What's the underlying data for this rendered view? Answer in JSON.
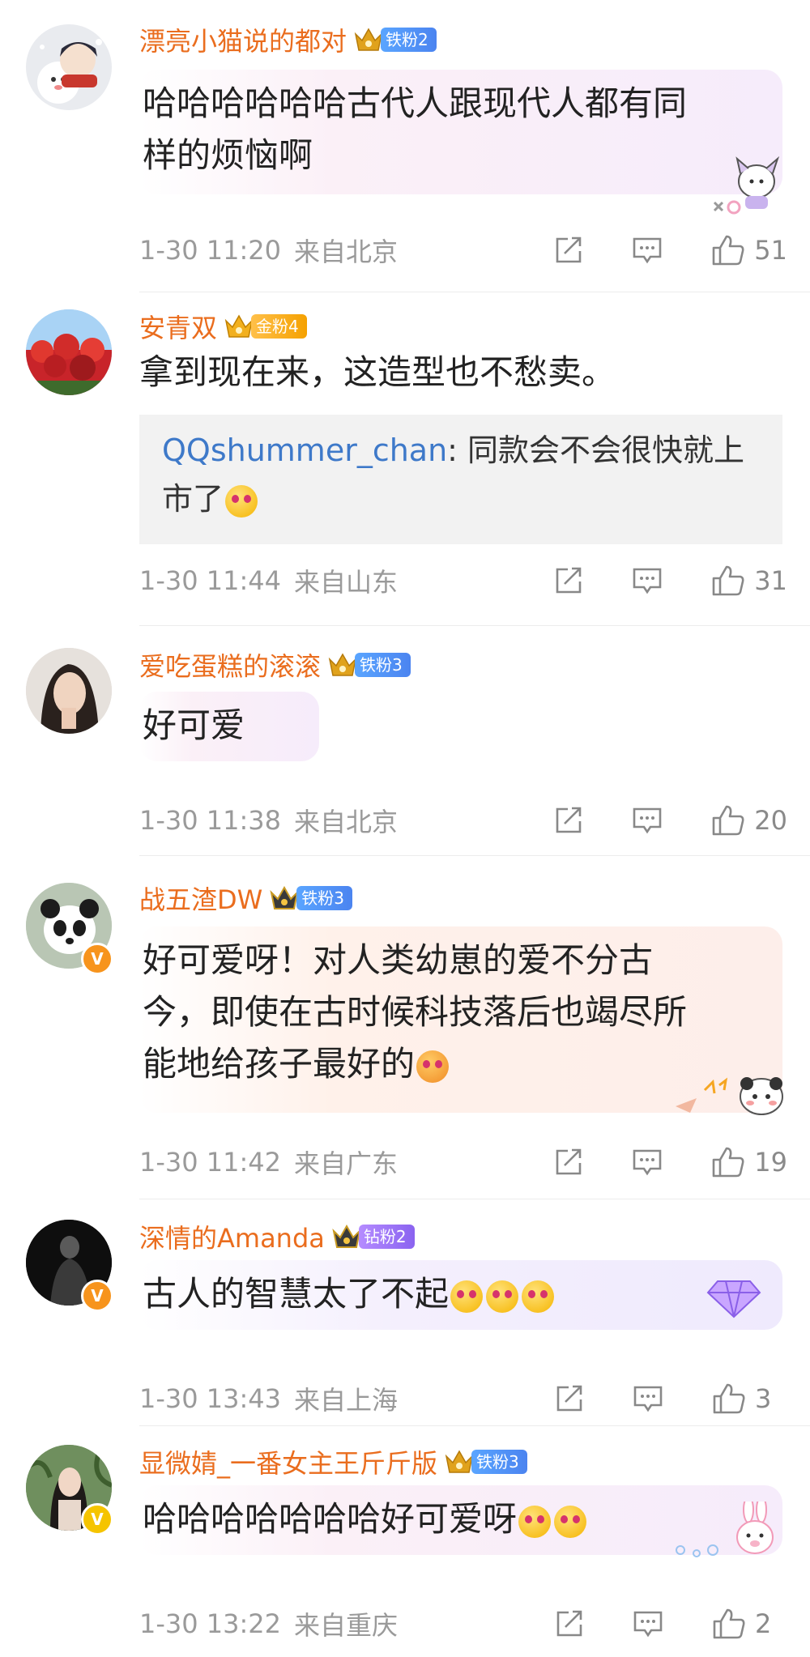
{
  "comments": [
    {
      "username": "漂亮小猫说的都对",
      "fan_badge": "铁粉2",
      "text_lines": [
        "哈哈哈哈哈哈古代人跟现代人都有同",
        "样的烦恼啊"
      ],
      "time": "1-30 11:20",
      "location": "来自北京",
      "likes": "51"
    },
    {
      "username": "安青双",
      "fan_badge": "金粉4",
      "text": "拿到现在来，这造型也不愁卖。",
      "quote_user": "QQshummer_chan",
      "quote_text_1": ": 同款会不会很快就上",
      "quote_text_2": "市了",
      "time": "1-30 11:44",
      "location": "来自山东",
      "likes": "31"
    },
    {
      "username": "爱吃蛋糕的滚滚",
      "fan_badge": "铁粉3",
      "text": "好可爱",
      "time": "1-30 11:38",
      "location": "来自北京",
      "likes": "20"
    },
    {
      "username": "战五渣DW",
      "fan_badge": "铁粉3",
      "text_lines": [
        "好可爱呀！对人类幼崽的爱不分古",
        "今，即使在古时候科技落后也竭尽所",
        "能地给孩子最好的"
      ],
      "time": "1-30 11:42",
      "location": "来自广东",
      "likes": "19"
    },
    {
      "username": "深情的Amanda",
      "fan_badge": "钻粉2",
      "text": "古人的智慧太了不起",
      "time": "1-30 13:43",
      "location": "来自上海",
      "likes": "3"
    },
    {
      "username": "显微婧_一番女主王斤斤版",
      "fan_badge": "铁粉3",
      "text": "哈哈哈哈哈哈哈好可爱呀",
      "time": "1-30 13:22",
      "location": "来自重庆",
      "likes": "2"
    }
  ],
  "colors": {
    "username": "#ea6d1e",
    "meta": "#9a9a9a",
    "quote_user": "#3e79c9",
    "iron_badge": "#4b84f0",
    "gold_badge": "#f5a100",
    "diamond_badge": "#8a63f0",
    "verified": "#f7941d"
  },
  "icons": [
    "crown-icon",
    "repost-icon",
    "comment-icon",
    "like-icon",
    "verified-v-icon",
    "laugh-cry-emoji",
    "love-emoji"
  ]
}
